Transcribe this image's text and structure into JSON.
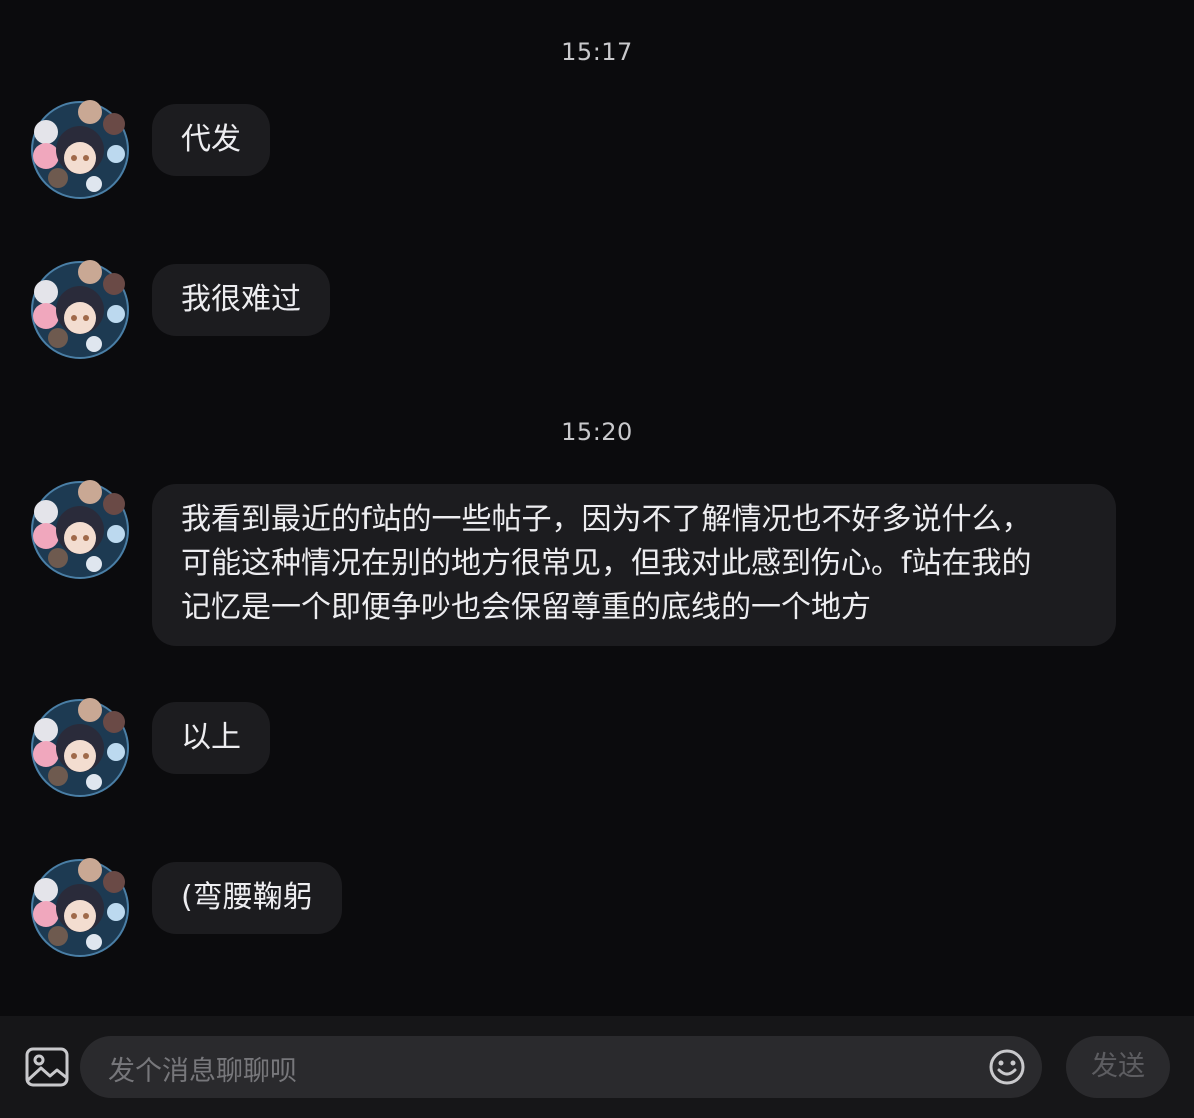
{
  "timestamps": [
    "15:17",
    "15:20"
  ],
  "messages": [
    {
      "text": "代发"
    },
    {
      "text": "我很难过"
    },
    {
      "text": "我看到最近的f站的一些帖子，因为不了解情况也不好多说什么，\n可能这种情况在别的地方很常见，但我对此感到伤心。f站在我的\n记忆是一个即便争吵也会保留尊重的底线的一个地方"
    },
    {
      "text": "以上"
    },
    {
      "text": "(弯腰鞠躬"
    }
  ],
  "composer": {
    "placeholder": "发个消息聊聊呗",
    "send_label": "发送"
  },
  "colors": {
    "background": "#0b0b0d",
    "bubble": "#1c1c1f",
    "bottom_bar": "#161618",
    "input": "#2a2a2d"
  }
}
